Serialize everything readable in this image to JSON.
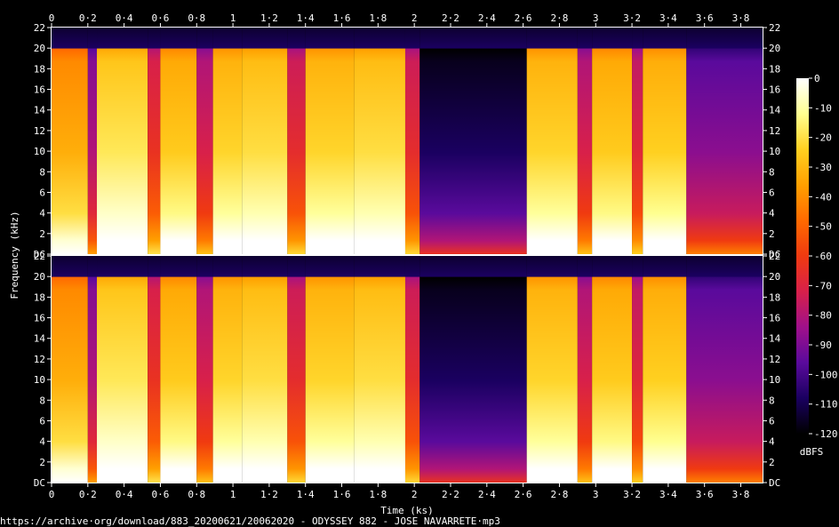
{
  "chart_data": {
    "type": "heatmap",
    "subtype": "spectrogram",
    "channels": 2,
    "xlabel": "Time (ks)",
    "ylabel": "Frequency (kHz)",
    "xlim": [
      0,
      3.92
    ],
    "ylim": [
      0,
      22
    ],
    "x_ticks": [
      "0",
      "0·2",
      "0·4",
      "0·6",
      "0·8",
      "1",
      "1·2",
      "1·4",
      "1·6",
      "1·8",
      "2",
      "2·2",
      "2·4",
      "2·6",
      "2·8",
      "3",
      "3·2",
      "3·4",
      "3·6",
      "3·8"
    ],
    "x_tick_values": [
      0,
      0.2,
      0.4,
      0.6,
      0.8,
      1.0,
      1.2,
      1.4,
      1.6,
      1.8,
      2.0,
      2.2,
      2.4,
      2.6,
      2.8,
      3.0,
      3.2,
      3.4,
      3.6,
      3.8
    ],
    "y_ticks": [
      "DC",
      "2",
      "4",
      "6",
      "8",
      "10",
      "12",
      "14",
      "16",
      "18",
      "20",
      "22"
    ],
    "y_tick_values": [
      0,
      2,
      4,
      6,
      8,
      10,
      12,
      14,
      16,
      18,
      20,
      22
    ],
    "colorbar": {
      "label": "dBFS",
      "range": [
        -120,
        0
      ],
      "ticks": [
        "0",
        "-10",
        "-20",
        "-30",
        "-40",
        "-50",
        "-60",
        "-70",
        "-80",
        "-90",
        "-100",
        "-110",
        "-120"
      ],
      "tick_values": [
        0,
        -10,
        -20,
        -30,
        -40,
        -50,
        -60,
        -70,
        -80,
        -90,
        -100,
        -110,
        -120
      ],
      "colors": [
        "#000000",
        "#1a0060",
        "#5a0a9c",
        "#a0108a",
        "#d8204a",
        "#f03a10",
        "#ff6a00",
        "#ffa000",
        "#ffd020",
        "#ffff90",
        "#ffffff"
      ]
    },
    "segments": [
      {
        "start": 0.0,
        "end": 0.2,
        "level": 0.78
      },
      {
        "start": 0.2,
        "end": 0.25,
        "level": 0.38
      },
      {
        "start": 0.25,
        "end": 0.53,
        "level": 0.9
      },
      {
        "start": 0.53,
        "end": 0.6,
        "level": 0.52
      },
      {
        "start": 0.6,
        "end": 0.8,
        "level": 0.84
      },
      {
        "start": 0.8,
        "end": 0.89,
        "level": 0.45
      },
      {
        "start": 0.89,
        "end": 1.05,
        "level": 0.86
      },
      {
        "start": 1.05,
        "end": 1.3,
        "level": 0.88
      },
      {
        "start": 1.3,
        "end": 1.4,
        "level": 0.5
      },
      {
        "start": 1.4,
        "end": 1.67,
        "level": 0.86
      },
      {
        "start": 1.67,
        "end": 1.95,
        "level": 0.88
      },
      {
        "start": 1.95,
        "end": 2.03,
        "level": 0.5
      },
      {
        "start": 2.03,
        "end": 2.62,
        "level": 0.15
      },
      {
        "start": 2.62,
        "end": 2.9,
        "level": 0.86
      },
      {
        "start": 2.9,
        "end": 2.98,
        "level": 0.45
      },
      {
        "start": 2.98,
        "end": 3.2,
        "level": 0.84
      },
      {
        "start": 3.2,
        "end": 3.26,
        "level": 0.48
      },
      {
        "start": 3.26,
        "end": 3.5,
        "level": 0.85
      },
      {
        "start": 3.5,
        "end": 3.92,
        "level": 0.32
      }
    ]
  },
  "footer": {
    "source": "https://archive·org/download/883_20200621/20062020 - ODYSSEY 882 - JOSE NAVARRETE·mp3"
  }
}
